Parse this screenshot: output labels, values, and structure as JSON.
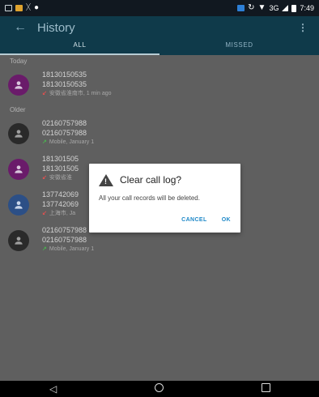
{
  "status_bar": {
    "network": "3G",
    "time": "7:49",
    "left_icons": [
      "notification-icon",
      "image-icon",
      "bluetooth-icon",
      "location-icon"
    ],
    "right_icons": [
      "sim-icon",
      "sync-icon",
      "wifi-icon",
      "signal-icon",
      "battery-icon"
    ]
  },
  "app_bar": {
    "title": "History",
    "back_icon": "arrow-left-icon",
    "menu_icon": "overflow-menu-icon"
  },
  "tabs": [
    {
      "label": "ALL",
      "active": true
    },
    {
      "label": "MISSED",
      "active": false
    }
  ],
  "sections": {
    "today": "Today",
    "older": "Older"
  },
  "call_log": [
    {
      "section": "Today",
      "number": "18130150535",
      "number2": "18130150535",
      "detail": "安徽省淮南市, 1 min ago",
      "type": "missed",
      "avatar_color": "#6a1b6a"
    },
    {
      "section": "Older",
      "number": "02160757988",
      "number2": "02160757988",
      "detail": "Mobile, January 1",
      "type": "outgoing",
      "avatar_color": "#2a2a2a"
    },
    {
      "section": "Older",
      "number": "181301505",
      "number2": "181301505",
      "detail": "安徽省淮",
      "type": "missed",
      "avatar_color": "#6a1b6a"
    },
    {
      "section": "Older",
      "number": "137742069",
      "number2": "137742069",
      "detail": "上海市, Ja",
      "type": "missed",
      "avatar_color": "#2c4f86"
    },
    {
      "section": "Older",
      "number": "02160757988",
      "number2": "02160757988",
      "detail": "Mobile, January 1",
      "type": "outgoing",
      "avatar_color": "#2a2a2a"
    }
  ],
  "dialog": {
    "title": "Clear call log?",
    "message": "All your call records will be deleted.",
    "cancel_label": "CANCEL",
    "ok_label": "OK",
    "warning_icon": "warning-icon"
  },
  "nav_bar": {
    "back_icon": "nav-back-icon",
    "home_icon": "nav-home-icon",
    "recents_icon": "nav-recents-icon"
  },
  "colors": {
    "app_bar": "#0f3a4a",
    "status_bar": "#111820",
    "list_bg": "#5f5f5f",
    "accent": "#1e88c8",
    "missed_arrow": "#e05050",
    "outgoing_arrow": "#4caf50"
  }
}
